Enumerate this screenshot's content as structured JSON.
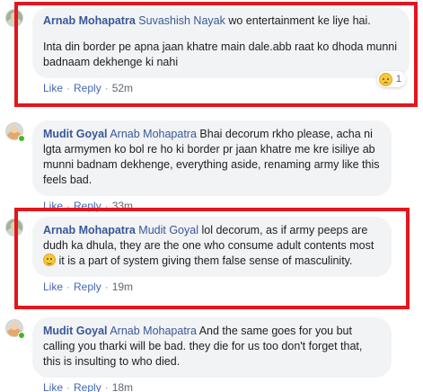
{
  "comments": [
    {
      "author": "Arnab Mohapatra",
      "mention": "Suvashish Nayak",
      "text1": "wo entertainment ke liye hai.",
      "text2": "Inta din border pe apna jaan khatre main dale.abb raat ko dhoda munni badnaam dekhenge ki nahi",
      "like": "Like",
      "reply": "Reply",
      "time": "52m",
      "reaction_count": "1",
      "reaction_icon": "sad-reaction-icon"
    },
    {
      "author": "Mudit Goyal",
      "mention": "Arnab Mohapatra",
      "text1": "Bhai decorum rkho please, acha ni lgta armymen ko bol re ho ki border pr jaan khatre me kre isiliye ab munni badnam dekhenge, everything aside, renaming army like this feels bad.",
      "like": "Like",
      "reply": "Reply",
      "time": "33m"
    },
    {
      "author": "Arnab Mohapatra",
      "mention": "Mudit Goyal",
      "text1": "lol decorum, as if army peeps are dudh ka dhula, they are the one who consume adult contents most",
      "text1b": "it is a part of system giving them false sense of masculinity.",
      "like": "Like",
      "reply": "Reply",
      "time": "19m"
    },
    {
      "author": "Mudit Goyal",
      "mention": "Arnab Mohapatra",
      "text1": "And the same goes for you but calling you tharki will be bad. they die for us too don't forget that, this is insulting to who died.",
      "like": "Like",
      "reply": "Reply",
      "time": "18m"
    }
  ],
  "colors": {
    "highlight": "#e3161d",
    "link": "#385898",
    "bubble": "#f2f3f5"
  }
}
